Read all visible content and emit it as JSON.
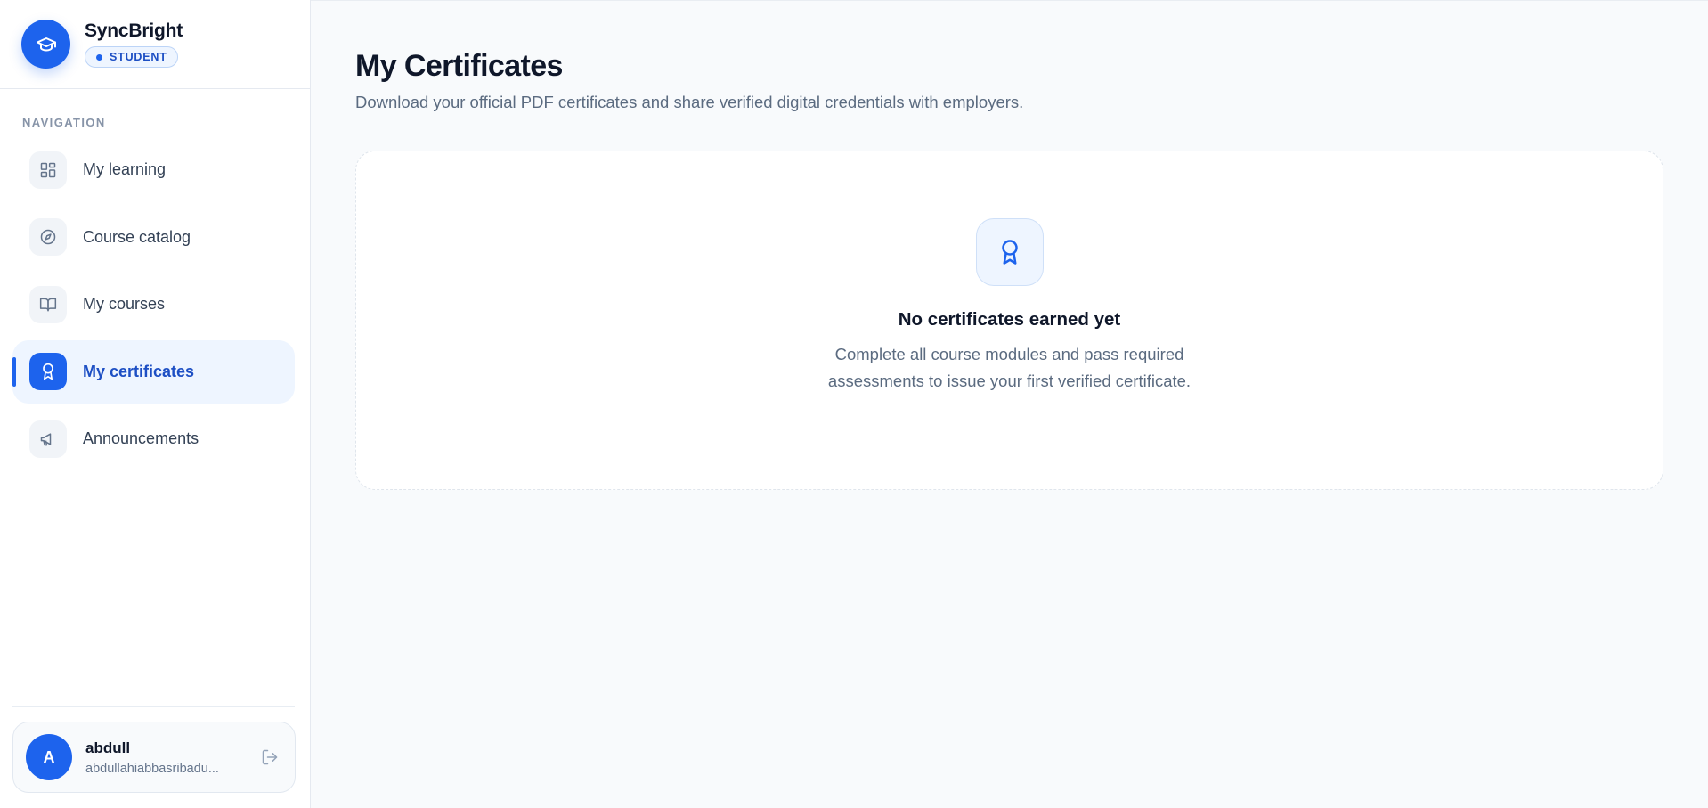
{
  "brand": {
    "name": "SyncBright",
    "role": "STUDENT"
  },
  "nav": {
    "heading": "NAVIGATION",
    "items": [
      {
        "label": "My learning",
        "icon": "dashboard-icon",
        "active": false
      },
      {
        "label": "Course catalog",
        "icon": "compass-icon",
        "active": false
      },
      {
        "label": "My courses",
        "icon": "book-open-icon",
        "active": false
      },
      {
        "label": "My certificates",
        "icon": "award-icon",
        "active": true
      },
      {
        "label": "Announcements",
        "icon": "megaphone-icon",
        "active": false
      }
    ]
  },
  "user": {
    "initial": "A",
    "name": "abdull",
    "email": "abdullahiabbasribadu..."
  },
  "main": {
    "title": "My Certificates",
    "subtitle": "Download your official PDF certificates and share verified digital credentials with employers.",
    "empty": {
      "title": "No certificates earned yet",
      "text": "Complete all course modules and pass required assessments to issue your first verified certificate."
    }
  },
  "colors": {
    "accent": "#1d63ed",
    "accent_soft": "#eef5ff",
    "text": "#0f172a",
    "muted": "#5b6b80"
  }
}
